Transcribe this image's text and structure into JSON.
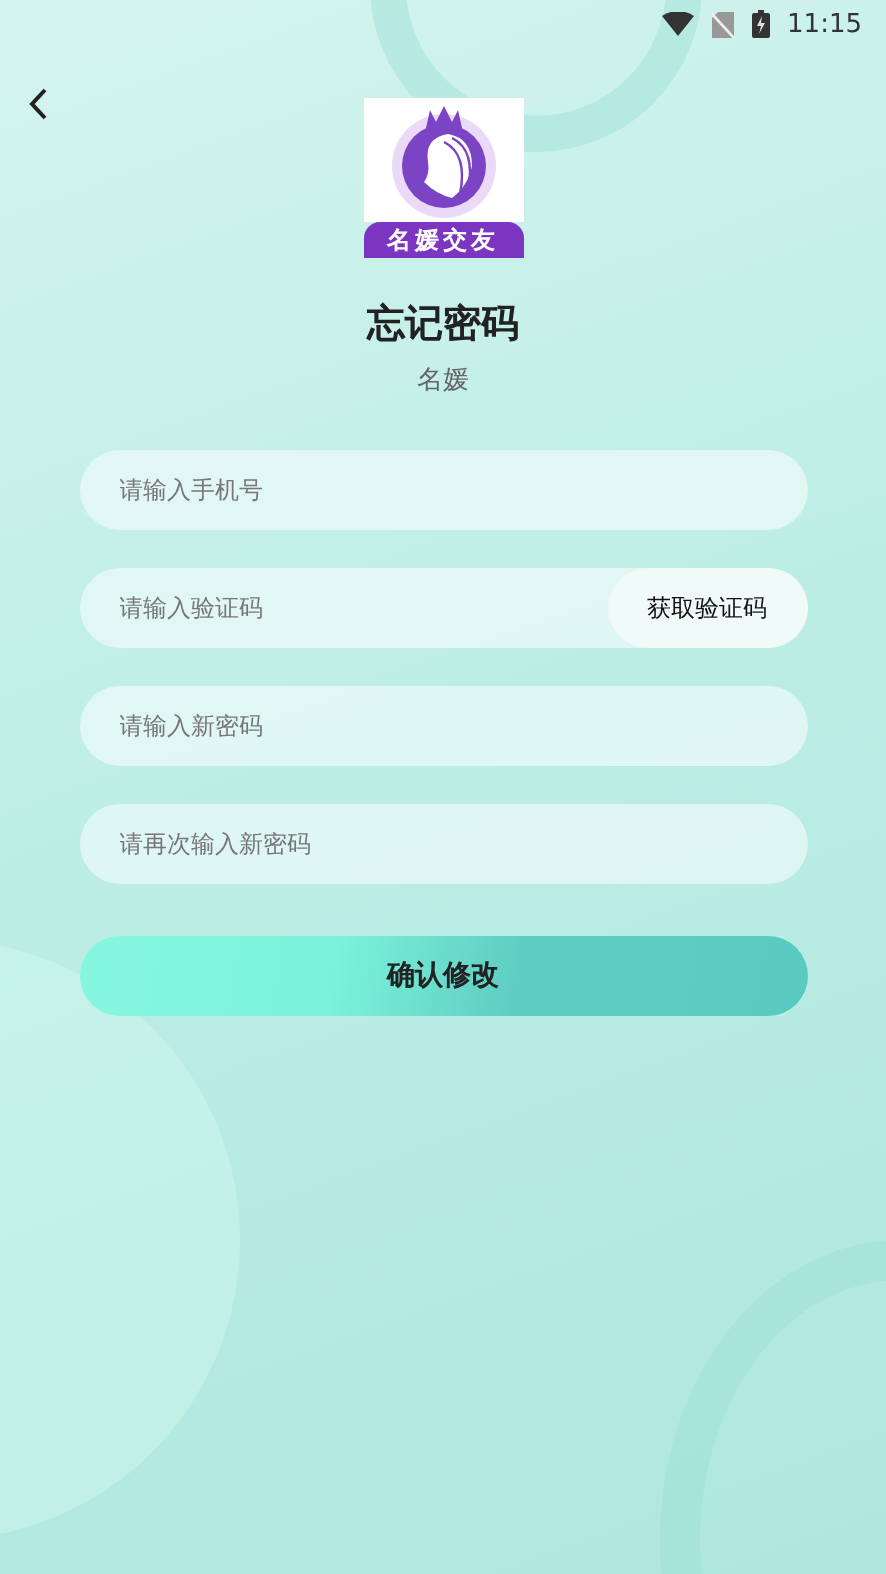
{
  "status_bar": {
    "time": "11:15"
  },
  "logo": {
    "caption": "名媛交友"
  },
  "title": "忘记密码",
  "subtitle": "名媛",
  "fields": [
    {
      "kind": "plain",
      "placeholder": "请输入手机号"
    },
    {
      "kind": "code",
      "placeholder": "请输入验证码",
      "button": "获取验证码"
    },
    {
      "kind": "plain",
      "placeholder": "请输入新密码"
    },
    {
      "kind": "plain",
      "placeholder": "请再次输入新密码"
    }
  ],
  "submit": "确认修改"
}
